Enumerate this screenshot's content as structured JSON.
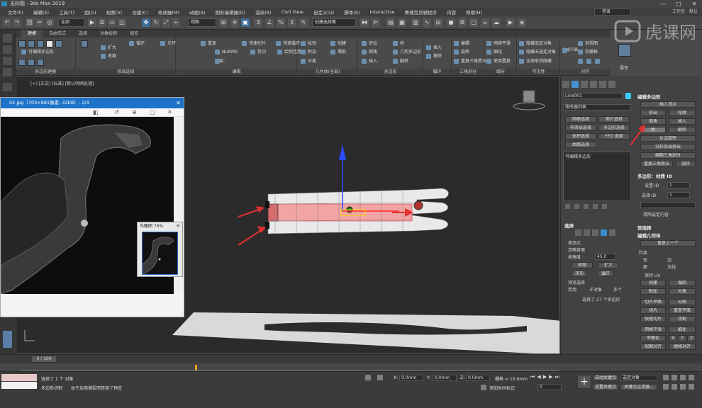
{
  "window": {
    "title": "无标题 - 3ds Max 2019",
    "controls": [
      "—",
      "□",
      "✕"
    ]
  },
  "menu": [
    "文件(F)",
    "编辑(E)",
    "工具(T)",
    "组(G)",
    "视图(V)",
    "创建(C)",
    "修改器(M)",
    "动画(A)",
    "图形编辑器(D)",
    "渲染(R)",
    "Civil View",
    "自定义(U)",
    "脚本(S)",
    "Interactive",
    "菁理克剪辑程序",
    "内容",
    "帮助(H)"
  ],
  "signin": "登录",
  "workspace": "工作区：默认",
  "toolbar": {
    "filter": "全部",
    "view": "视图",
    "named_set": "创建选择集"
  },
  "ribbon": {
    "tabs": [
      "建模",
      "自由形式",
      "选择",
      "对象绘制",
      "填充"
    ],
    "group_labels": [
      "多边形建模",
      "修改选择",
      "编辑",
      "几何体(全部)",
      "多边形",
      "循环",
      "三角剖分",
      "细分",
      "可见性",
      "对齐",
      "属性"
    ],
    "items": {
      "mod_sel": [
        "扩大",
        "收缩",
        "循环",
        "光环"
      ],
      "edit": [
        "重复",
        "快速切片",
        "快速循环",
        "NURMS",
        "剪切",
        "绘制连接",
        "约束:"
      ],
      "geom": [
        "松弛",
        "创建",
        "附加",
        "塌陷",
        "分离"
      ],
      "poly": [
        "挤出",
        "桥",
        "倒角",
        "几何多边形",
        "插入",
        "翻转"
      ],
      "loop": [
        "插入",
        "移除"
      ],
      "tri": [
        "编辑",
        "旋转",
        "重复三角算法"
      ],
      "sub": [
        "网格平滑",
        "细化",
        "使用置换"
      ],
      "vis": [
        "隐藏选定对象",
        "隐藏未选定对象",
        "全部取消隐藏"
      ],
      "align": [
        "生成平面",
        "到视图",
        "到栅格",
        "X",
        "Y",
        "Z"
      ],
      "editable_poly": "可编辑多边形"
    }
  },
  "viewport": {
    "label": "[+] [正交] [标准] [默认明暗处理]"
  },
  "viewer": {
    "title": "02.jpg（703×681像素, 32KB）- 2/3",
    "nav_title": "鸟瞰图 76%"
  },
  "cmd": {
    "object_name": "Line001",
    "modifier_list": "修改器列表",
    "mod_buttons": [
      "网格选择",
      "面片选择",
      "样条线选择",
      "多边形选择",
      "体积选择",
      "FFD 选择",
      "曲面选择"
    ],
    "stack_item": "可编辑多边形",
    "selection": {
      "title": "选择",
      "by_vertex": "按顶点",
      "ignore_backfacing": "忽略背面",
      "by_angle": "按角度",
      "angle_value": "45.0",
      "shrink": "收缩",
      "grow": "扩大",
      "ring": "环形",
      "loop": "循环",
      "preview": "预览选择",
      "disabled": "禁用",
      "subobject": "子对象",
      "multi": "多个",
      "status": "选择了 27 个多边形"
    },
    "edit_poly": {
      "title": "编辑多边形",
      "buttons": [
        "插入顶点",
        "挤出",
        "轮廓",
        "倒角",
        "插入",
        "桥",
        "翻转",
        "从边旋转",
        "沿样条线挤出",
        "编辑三角剖分",
        "重复三角算法",
        "旋转"
      ]
    },
    "material": {
      "title": "多边形：材质 ID",
      "set_id": "设置 ID",
      "select_id": "选择 ID",
      "id1": "1",
      "id2": "1",
      "clear": "清除选定内容"
    },
    "soft_sel": "软选择",
    "edit_geom": {
      "title": "编辑几何体",
      "repeat": "重复上一个",
      "constraints": "约束",
      "none": "无",
      "edge": "边",
      "face": "面",
      "normal": "法线",
      "preserve_uv": "保持 UV",
      "create": "创建",
      "collapse": "塌陷",
      "attach": "附加",
      "detach": "分离",
      "slice_plane": "切片平面",
      "split": "分割",
      "slice": "切片",
      "reset_plane": "重置平面",
      "quickslice": "快速切片",
      "cut": "切割",
      "msmooth": "网格平滑",
      "tessellate": "细化",
      "make_planar": "平面化",
      "x": "X",
      "y": "Y",
      "z": "Z",
      "view_align": "视图对齐",
      "grid_align": "栅格对齐"
    }
  },
  "timeline": {
    "frame": "0 / 100"
  },
  "status": {
    "selected": "选择了 1 个 对象",
    "hint": "由于启用捕捉而禁用了预览",
    "tool": "多边形切割",
    "x_label": "X:",
    "x": "0.0mm",
    "y_label": "Y:",
    "y": "0.0mm",
    "z_label": "Z:",
    "z": "0.0mm",
    "grid": "栅格 = 10.0mm",
    "addtime": "添加时间标记",
    "autokey": "自动关键点",
    "setkey": "设置关键点",
    "selected_obj": "选定对象",
    "key_filter": "关键点过滤器...",
    "frame_field": "0"
  },
  "watermark": "虎课网"
}
